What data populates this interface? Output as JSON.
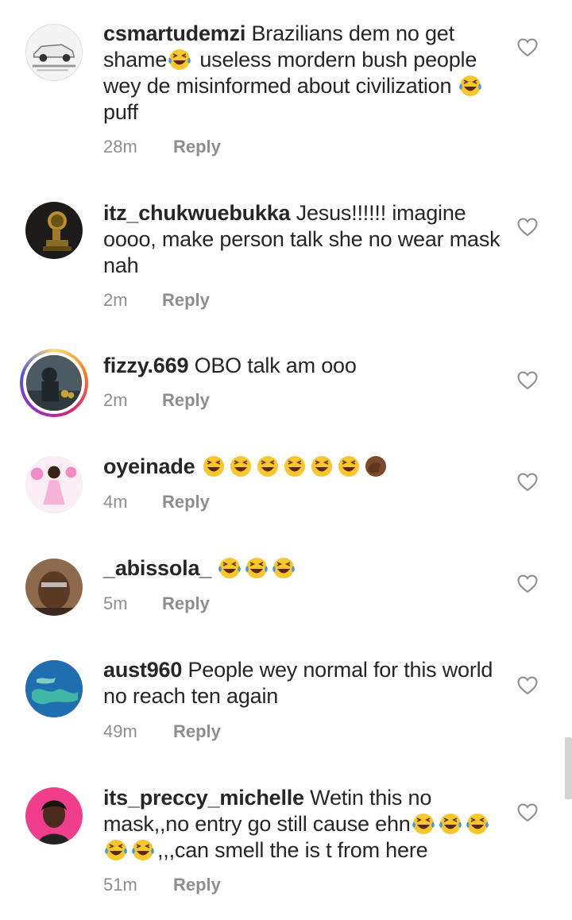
{
  "comments": [
    {
      "username": "csmartudemzi",
      "segments": [
        " Brazilians dem no get shame",
        "laugh",
        " useless mordern bush people wey de misinformed about civilization ",
        "laugh",
        " puff"
      ],
      "time": "28m",
      "reply": "Reply",
      "avatar_icon": "car-photo-avatar"
    },
    {
      "username": "itz_chukwuebukka",
      "segments": [
        " Jesus!!!!!! imagine oooo,  make person talk she no wear mask nah"
      ],
      "time": "2m",
      "reply": "Reply",
      "avatar_icon": "grammy-trophy-avatar"
    },
    {
      "username": "fizzy.669",
      "segments": [
        " OBO talk am ooo"
      ],
      "time": "2m",
      "reply": "Reply",
      "avatar_icon": "dark-figure-avatar"
    },
    {
      "username": "oyeinade",
      "segments": [
        " ",
        "grin",
        "grin",
        "grin",
        "grin",
        "grin",
        "grin",
        "facepalm"
      ],
      "time": "4m",
      "reply": "Reply",
      "avatar_icon": "child-pink-dress-avatar"
    },
    {
      "username": "_abissola_",
      "segments": [
        " ",
        "laugh",
        "laugh",
        "laugh"
      ],
      "time": "5m",
      "reply": "Reply",
      "avatar_icon": "woman-selfie-avatar"
    },
    {
      "username": "aust960",
      "segments": [
        " People wey normal for this world no reach ten again"
      ],
      "time": "49m",
      "reply": "Reply",
      "avatar_icon": "earth-globe-avatar"
    },
    {
      "username": "its_preccy_michelle",
      "segments": [
        " Wetin this no mask,,no entry go still cause ehn",
        "laugh",
        "laugh",
        "laugh",
        "laugh",
        "laugh",
        ",,,can smell the is t from here"
      ],
      "time": "51m",
      "reply": "Reply",
      "avatar_icon": "woman-portrait-avatar"
    }
  ],
  "icons": {
    "like": "heart-outline-icon"
  },
  "colors": {
    "text": "#262626",
    "meta": "#8e8e8e",
    "laugh_face": "#f9c62d",
    "tears": "#3b9ae1"
  }
}
